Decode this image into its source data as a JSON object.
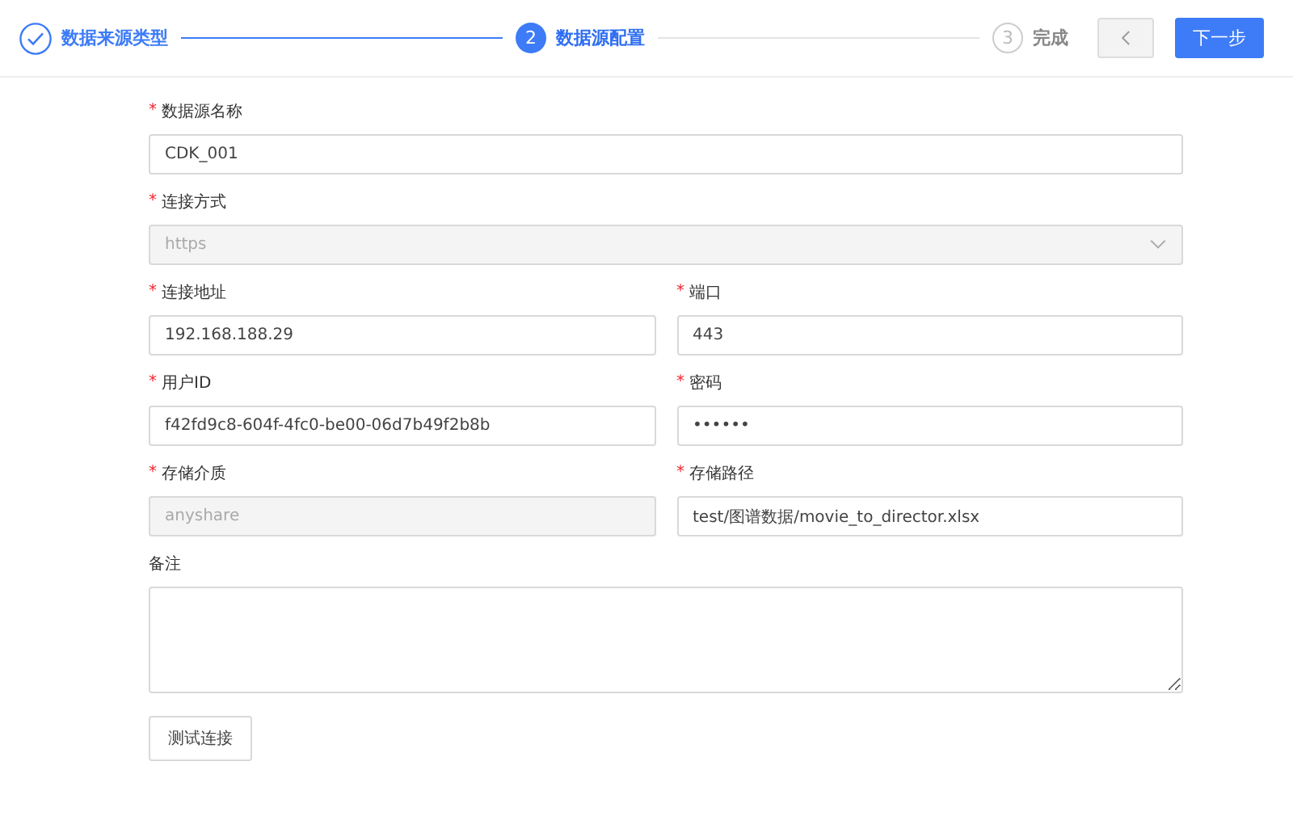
{
  "steps": [
    {
      "label": "数据来源类型",
      "completed": true,
      "selected": false
    },
    {
      "label": "数据源配置",
      "completed": false,
      "selected": true,
      "number": "2"
    },
    {
      "label": "完成",
      "completed": false,
      "selected": false,
      "number": "3"
    }
  ],
  "nav": {
    "back_disabled": true,
    "next": "下一步"
  },
  "rows": [
    [
      {
        "label": "数据源名称",
        "required_mark": "*",
        "kind": "text",
        "value": "CDK_001"
      }
    ],
    [
      {
        "label": "连接方式",
        "required_mark": "*",
        "kind": "select",
        "value": "https",
        "disabled": true
      }
    ],
    [
      {
        "label": "连接地址",
        "required_mark": "*",
        "kind": "text",
        "value": "192.168.188.29"
      },
      {
        "label": "端口",
        "required_mark": "*",
        "kind": "text",
        "value": "443"
      }
    ],
    [
      {
        "label": "用户ID",
        "required_mark": "*",
        "kind": "text",
        "value": "f42fd9c8-604f-4fc0-be00-06d7b49f2b8b"
      },
      {
        "label": "密码",
        "required_mark": "*",
        "kind": "password",
        "value": "••••••"
      }
    ],
    [
      {
        "label": "存储介质",
        "required_mark": "*",
        "kind": "text",
        "value": "anyshare",
        "disabled": true
      },
      {
        "label": "存储路径",
        "required_mark": "*",
        "kind": "text",
        "value": "test/图谱数据/movie_to_director.xlsx"
      }
    ],
    [
      {
        "label": "备注",
        "kind": "textarea"
      }
    ]
  ],
  "test_button": "测试连接"
}
